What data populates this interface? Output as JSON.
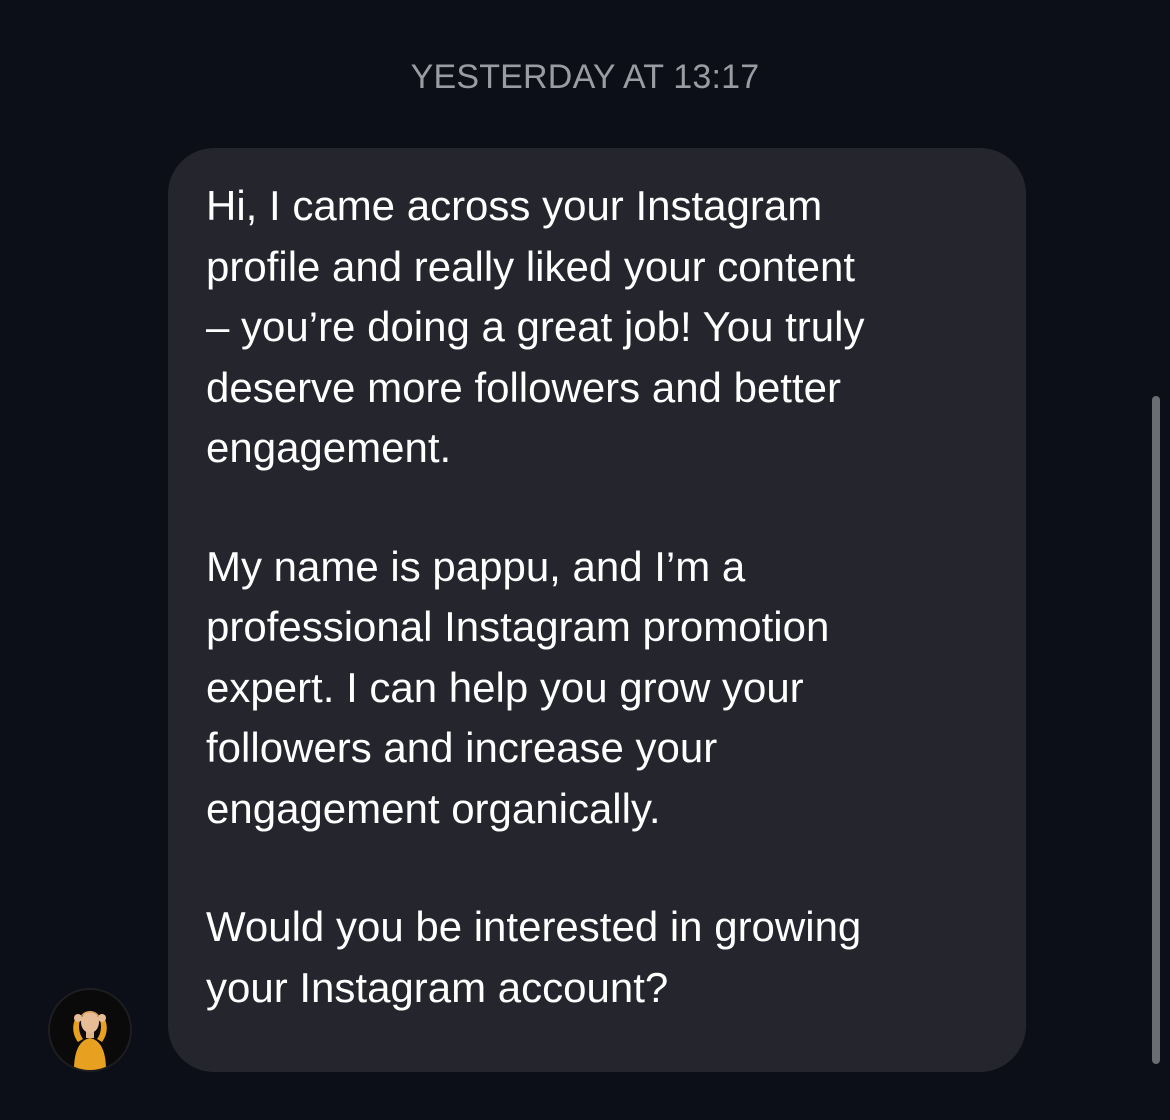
{
  "chat": {
    "timestamp": "YESTERDAY AT 13:17",
    "message": {
      "paragraphs": [
        "Hi, I came across your Instagram\nprofile and really liked your content\n– you’re doing a great job! You truly\ndeserve more followers and better\nengagement.",
        "My name is pappu,  and I’m a\nprofessional Instagram promotion\nexpert. I can help you grow your\nfollowers and increase your\nengagement organically.",
        "Would you be interested in growing\nyour Instagram account?"
      ]
    },
    "sender": {
      "avatar_icon": "user-avatar-icon"
    }
  },
  "colors": {
    "background": "#0c0f17",
    "bubble": "#24252d",
    "timestamp_text": "#9a9ca3",
    "message_text": "#ffffff",
    "avatar_accent": "#e8a020"
  }
}
